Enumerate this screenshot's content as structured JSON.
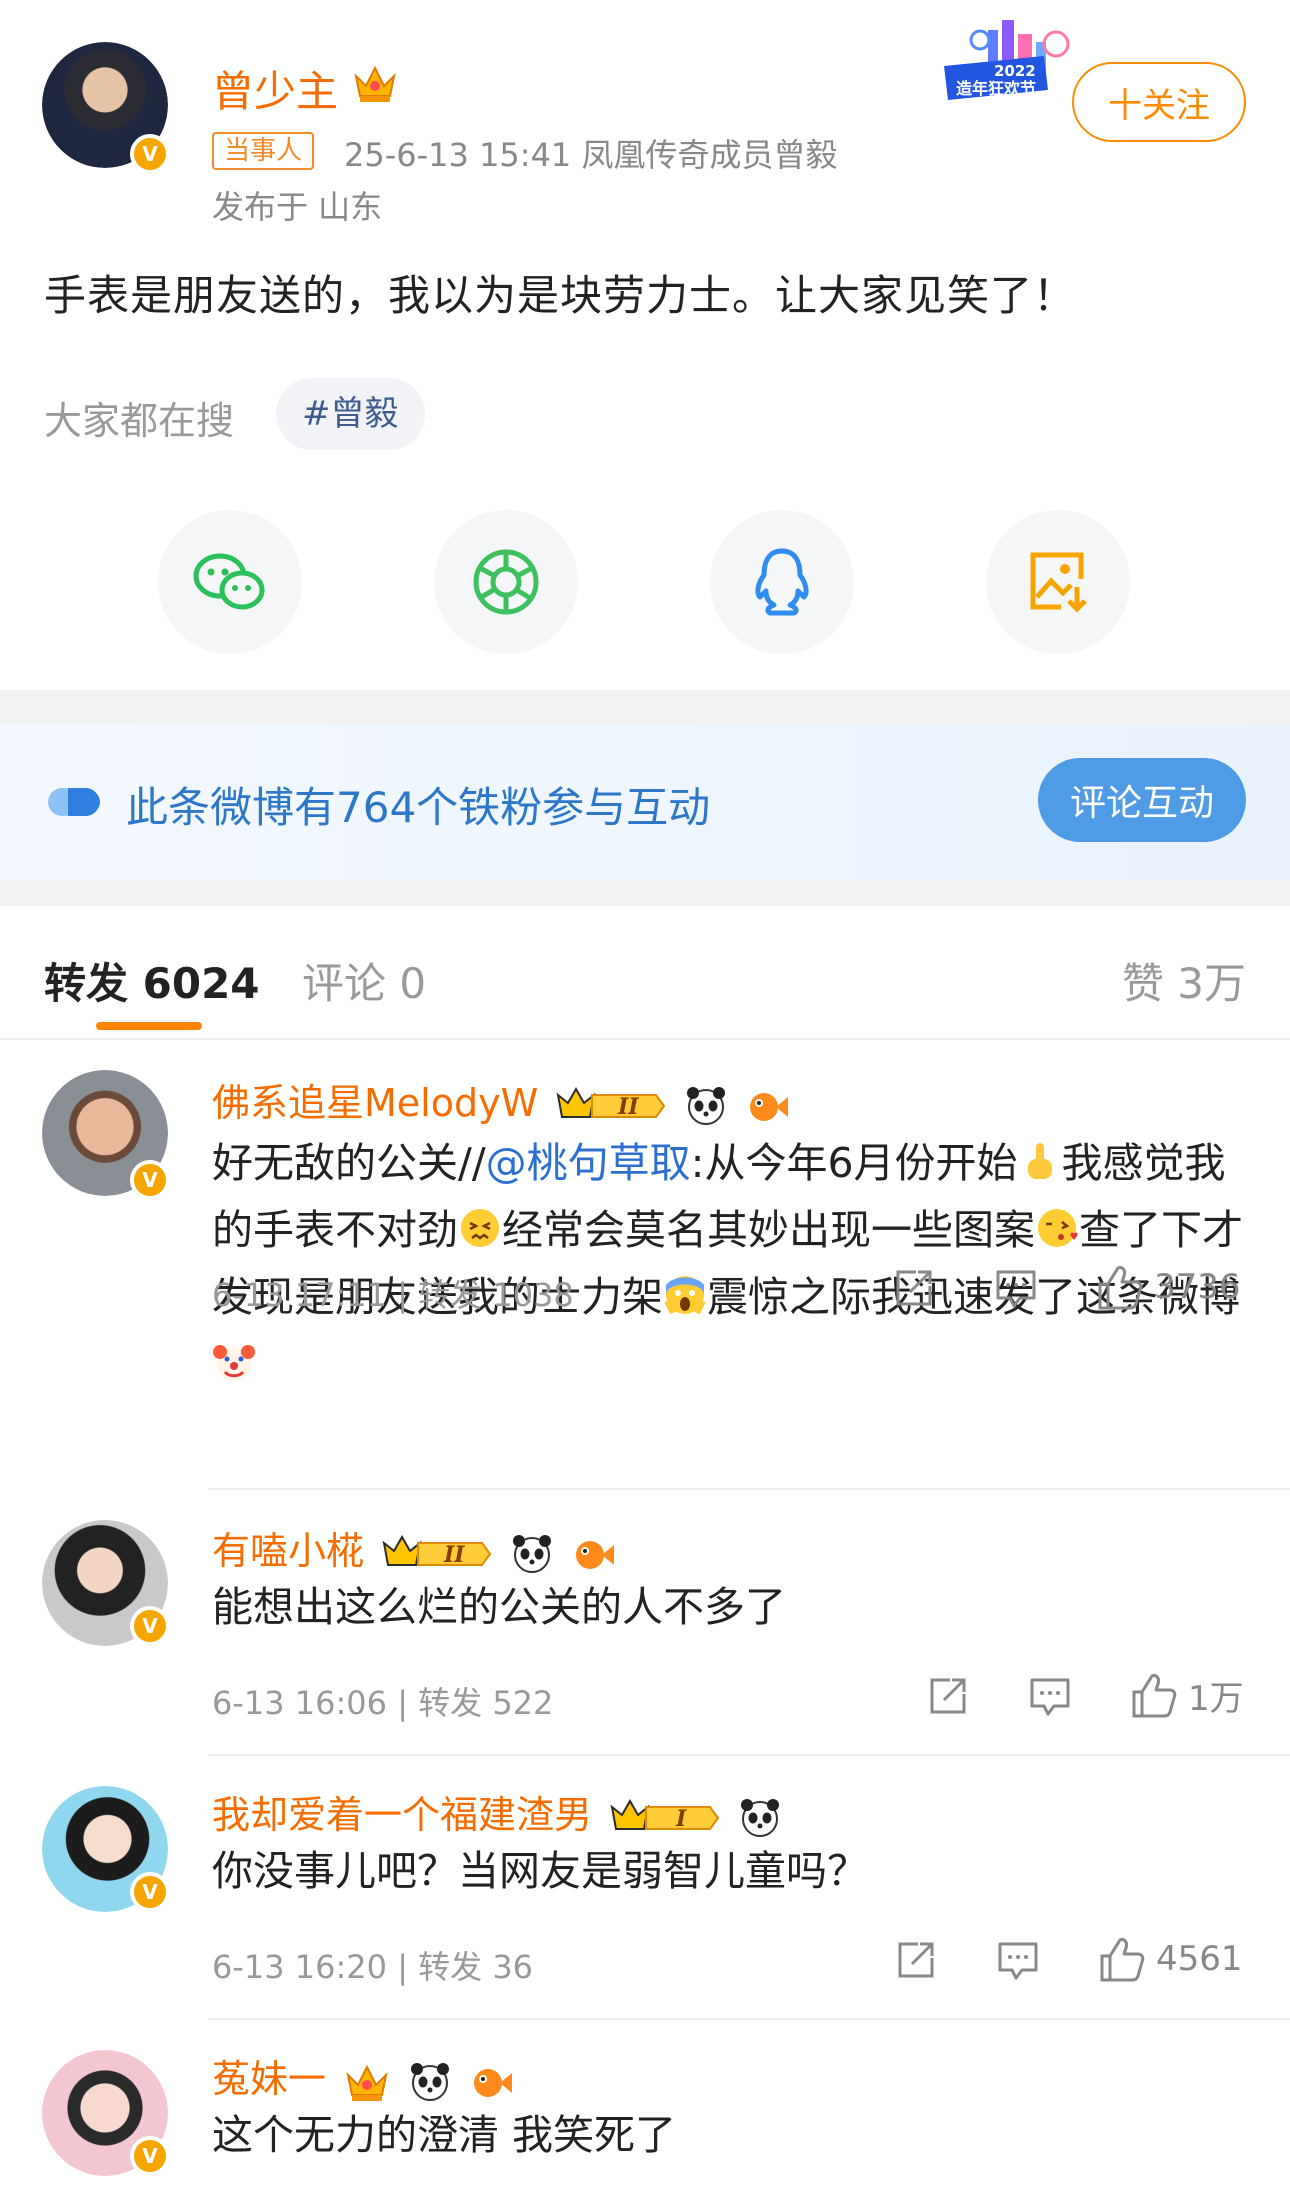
{
  "post": {
    "author": "曾少主",
    "tag": "当事人",
    "meta": "25-6-13 15:41  凤凰传奇成员曾毅",
    "location": "发布于 山东",
    "event_badge": "2022 造年狂欢节",
    "follow_label": "十关注",
    "text": "手表是朋友送的，我以为是块劳力士。让大家见笑了！",
    "search_label": "大家都在搜",
    "search_chip": "#曾毅"
  },
  "fan_banner": {
    "text": "此条微博有764个铁粉参与互动",
    "button": "评论互动"
  },
  "tabs": {
    "repost": "转发 6024",
    "comments": "评论 0",
    "likes": "赞 3万"
  },
  "comments": [
    {
      "name": "佛系追星MelodyW",
      "text_before": "好无敌的公关//",
      "mention": "@桃句草取",
      "text_after_1": ":从今年6月份开始",
      "text_after_2": "我感觉我的手表不对劲",
      "text_after_3": "经常会莫名其妙出现一些图案",
      "text_after_4": "查了下才发现是朋友送我的士力架",
      "text_after_5": "震惊之际我迅速发了这条微博",
      "meta": "6-13 17:11 | 转发 1038",
      "likes": "3736"
    },
    {
      "name": "有嗑小椛",
      "text": "能想出这么烂的公关的人不多了",
      "meta": "6-13 16:06 | 转发 522",
      "likes": "1万"
    },
    {
      "name": "我却爱着一个福建渣男",
      "text": "你没事儿吧？当网友是弱智儿童吗？",
      "meta": "6-13 16:20 | 转发 36",
      "likes": "4561"
    },
    {
      "name": "菟妹一",
      "text": "这个无力的澄清 我笑死了"
    }
  ]
}
